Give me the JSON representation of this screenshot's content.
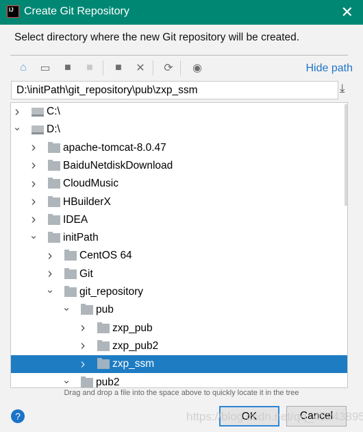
{
  "window": {
    "title": "Create Git Repository",
    "logo_text": "IJ"
  },
  "description": "Select directory where the new Git repository will be created.",
  "toolbar": {
    "icons": [
      "home-icon",
      "desktop-icon",
      "project-folder-icon",
      "module-folder-icon",
      "new-folder-icon",
      "delete-icon",
      "refresh-icon",
      "show-hidden-icon"
    ],
    "hide_path": "Hide path"
  },
  "path_field": {
    "value": "D:\\initPath\\git_repository\\pub\\zxp_ssm"
  },
  "tree": [
    {
      "label": "C:\\",
      "level": 0,
      "expanded": false,
      "type": "drive"
    },
    {
      "label": "D:\\",
      "level": 0,
      "expanded": true,
      "type": "drive"
    },
    {
      "label": "apache-tomcat-8.0.47",
      "level": 1,
      "expanded": false
    },
    {
      "label": "BaiduNetdiskDownload",
      "level": 1,
      "expanded": false
    },
    {
      "label": "CloudMusic",
      "level": 1,
      "expanded": false
    },
    {
      "label": "HBuilderX",
      "level": 1,
      "expanded": false
    },
    {
      "label": "IDEA",
      "level": 1,
      "expanded": false
    },
    {
      "label": "initPath",
      "level": 1,
      "expanded": true
    },
    {
      "label": "CentOS 64",
      "level": 2,
      "expanded": false
    },
    {
      "label": "Git",
      "level": 2,
      "expanded": false
    },
    {
      "label": "git_repository",
      "level": 2,
      "expanded": true
    },
    {
      "label": "pub",
      "level": 3,
      "expanded": true
    },
    {
      "label": "zxp_pub",
      "level": 4,
      "expanded": false
    },
    {
      "label": "zxp_pub2",
      "level": 4,
      "expanded": false
    },
    {
      "label": "zxp_ssm",
      "level": 4,
      "expanded": false,
      "selected": true
    },
    {
      "label": "pub2",
      "level": 3,
      "expanded": true
    }
  ],
  "hint": "Drag and drop a file into the space above to quickly locate it in the tree",
  "buttons": {
    "help": "?",
    "ok": "OK",
    "cancel": "Cancel"
  },
  "watermark": "https://blog.csdn.net/qq_45243895",
  "colors": {
    "titlebar": "#008774",
    "selection": "#1e7cc3",
    "link": "#2075c7"
  }
}
